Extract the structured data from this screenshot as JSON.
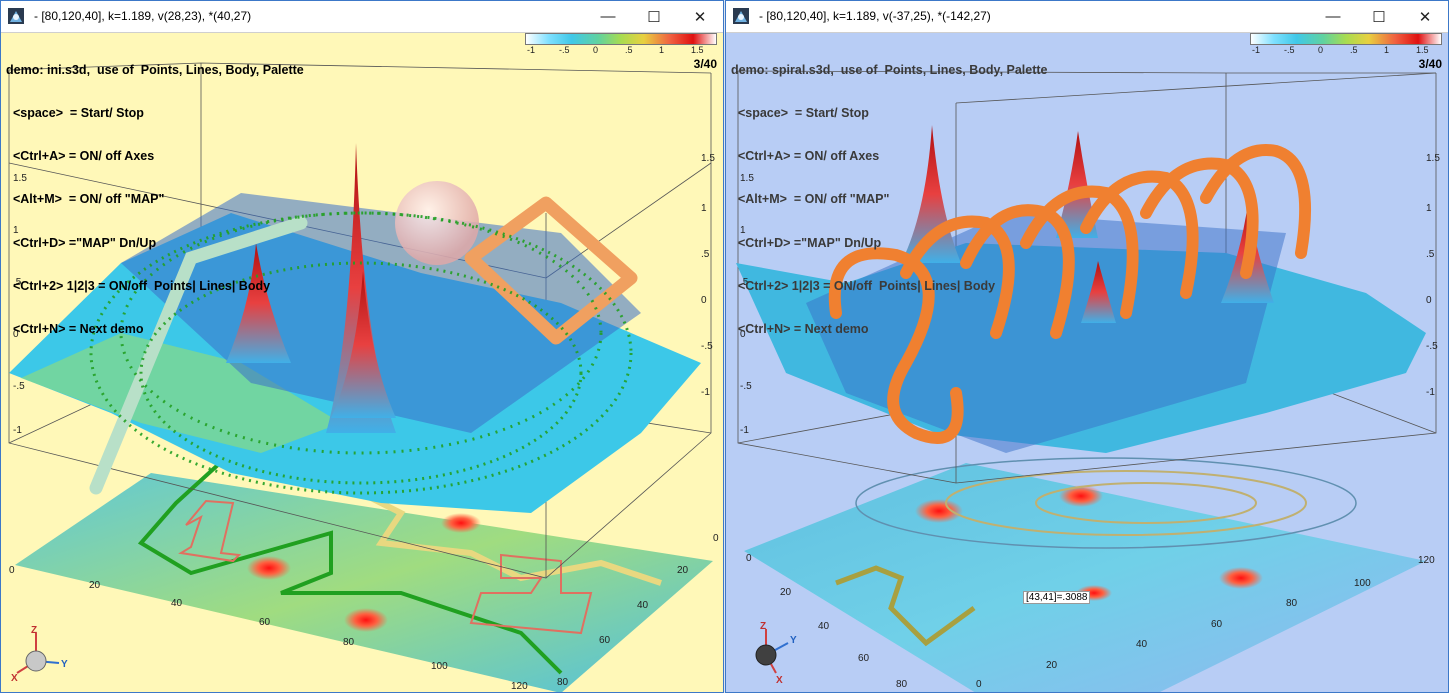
{
  "left": {
    "title": "- [80,120,40], k=1.189, v(28,23), *(40,27)",
    "help": [
      "demo: ini.s3d,  use of  Points, Lines, Body, Palette",
      "  <space>  = Start/ Stop",
      "  <Ctrl+A> = ON/ off Axes",
      "  <Alt+M>  = ON/ off \"MAP\"",
      "  <Ctrl+D> =\"MAP\" Dn/Up",
      "  <Ctrl+2> 1|2|3 = ON/off  Points| Lines| Body",
      "  <Ctrl+N> = Next demo"
    ],
    "counter": "3/40",
    "palette_ticks": [
      "-1",
      "-.5",
      "0",
      ".5",
      "1",
      "1.5"
    ],
    "z_ticks_left": [
      "1.5",
      "1",
      ".5",
      "0",
      "-.5",
      "-1"
    ],
    "z_ticks_right": [
      "1.5",
      "1",
      ".5",
      "0",
      "-.5",
      "-1"
    ],
    "x_ticks": [
      "0",
      "20",
      "40",
      "60",
      "80",
      "100",
      "120"
    ],
    "y_ticks": [
      "0",
      "20",
      "40",
      "60",
      "80"
    ],
    "axis_labels": {
      "z": "Z",
      "x": "X",
      "y": "Y"
    }
  },
  "right": {
    "title": "- [80,120,40], k=1.189, v(-37,25), *(-142,27)",
    "help": [
      "demo: spiral.s3d,  use of  Points, Lines, Body, Palette",
      "  <space>  = Start/ Stop",
      "  <Ctrl+A> = ON/ off Axes",
      "  <Alt+M>  = ON/ off \"MAP\"",
      "  <Ctrl+D> =\"MAP\" Dn/Up",
      "  <Ctrl+2> 1|2|3 = ON/off  Points| Lines| Body",
      "  <Ctrl+N> = Next demo"
    ],
    "counter": "3/40",
    "palette_ticks": [
      "-1",
      "-.5",
      "0",
      ".5",
      "1",
      "1.5"
    ],
    "z_ticks_left": [
      "1.5",
      "1",
      ".5",
      "0",
      "-.5",
      "-1"
    ],
    "z_ticks_right": [
      "1.5",
      "1",
      ".5",
      "0",
      "-.5",
      "-1"
    ],
    "x_ticks": [
      "0",
      "20",
      "40",
      "60",
      "80",
      "100",
      "120"
    ],
    "y_ticks": [
      "0",
      "20",
      "40",
      "60",
      "80"
    ],
    "probe": "[43,41]=.3088",
    "axis_labels": {
      "z": "Z",
      "x": "X",
      "y": "Y"
    }
  },
  "window_controls": {
    "minimize": "—",
    "maximize": "☐",
    "close": "✕"
  }
}
